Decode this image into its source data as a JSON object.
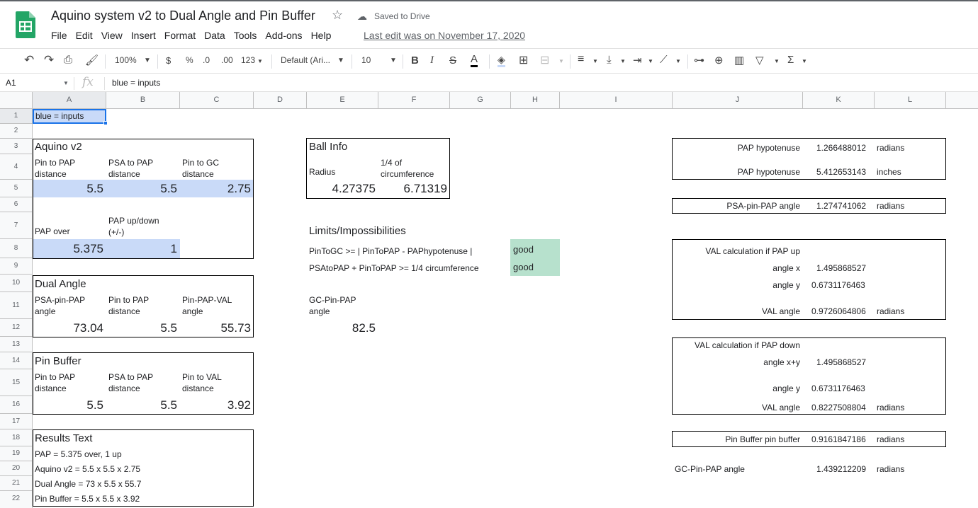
{
  "doc": {
    "title": "Aquino system v2 to Dual Angle and Pin Buffer",
    "saved": "Saved to Drive",
    "last_edit": "Last edit was on November 17, 2020",
    "menu": [
      "File",
      "Edit",
      "View",
      "Insert",
      "Format",
      "Data",
      "Tools",
      "Add-ons",
      "Help"
    ]
  },
  "toolbar": {
    "zoom": "100%",
    "currency": "$",
    "percent": "%",
    "dec_less": ".0",
    "dec_more": ".00",
    "format_more": "123",
    "font": "Default (Ari...",
    "font_size": "10"
  },
  "formula_bar": {
    "cell_ref": "A1",
    "fx": "fx",
    "value": "blue = inputs"
  },
  "columns": [
    "A",
    "B",
    "C",
    "D",
    "E",
    "F",
    "G",
    "H",
    "I",
    "J",
    "K",
    "L"
  ],
  "rows": [
    "1",
    "2",
    "3",
    "4",
    "5",
    "6",
    "7",
    "8",
    "9",
    "10",
    "11",
    "12",
    "13",
    "14",
    "15",
    "16",
    "17",
    "18",
    "19",
    "20",
    "21",
    "22"
  ],
  "cells": {
    "a1": "blue = inputs",
    "aquino": {
      "title": "Aquino v2",
      "pin_pap": "Pin to PAP\ndistance",
      "psa_pap": "PSA to PAP\ndistance",
      "pin_gc": "Pin to GC\ndistance",
      "v_pin_pap": "5.5",
      "v_psa_pap": "5.5",
      "v_pin_gc": "2.75",
      "pap_over": "PAP over",
      "pap_updown": "PAP up/down\n(+/-)",
      "v_pap_over": "5.375",
      "v_pap_updown": "1"
    },
    "dual": {
      "title": "Dual Angle",
      "psa_pin_pap": "PSA-pin-PAP\nangle",
      "pin_pap": "Pin to PAP\ndistance",
      "pin_pap_val": "Pin-PAP-VAL\nangle",
      "v1": "73.04",
      "v2": "5.5",
      "v3": "55.73"
    },
    "buffer": {
      "title": "Pin Buffer",
      "pin_pap": "Pin to PAP\ndistance",
      "psa_pap": "PSA to PAP\ndistance",
      "pin_val": "Pin to VAL\ndistance",
      "v1": "5.5",
      "v2": "5.5",
      "v3": "3.92"
    },
    "results": {
      "title": "Results Text",
      "lines": [
        "PAP = 5.375 over, 1 up",
        "Aquino v2 = 5.5 x 5.5 x 2.75",
        "Dual Angle = 73 x 5.5 x 55.7",
        "Pin Buffer = 5.5 x 5.5 x 3.92"
      ]
    },
    "ball": {
      "title": "Ball Info",
      "radius": "Radius",
      "quarter": "1/4 of\ncircumference",
      "v_radius": "4.27375",
      "v_quarter": "6.71319"
    },
    "limits": {
      "title": "Limits/Impossibilities",
      "rule1": "PinToGC >= | PinToPAP - PAPhypotenuse |",
      "rule2": "PSAtoPAP + PinToPAP >= 1/4 circumference",
      "r1": "good",
      "r2": "good"
    },
    "gc": {
      "label": "GC-Pin-PAP\nangle",
      "value": "82.5"
    },
    "calc": {
      "hyp1_label": "PAP hypotenuse",
      "hyp1_value": "1.266488012",
      "hyp1_unit": "radians",
      "hyp2_label": "PAP hypotenuse",
      "hyp2_value": "5.412653143",
      "hyp2_unit": "inches",
      "psa_label": "PSA-pin-PAP angle",
      "psa_value": "1.274741062",
      "psa_unit": "radians",
      "up_title": "VAL calculation if PAP up",
      "up_x_label": "angle x",
      "up_x": "1.495868527",
      "up_y_label": "angle y",
      "up_y": "0.6731176463",
      "up_val_label": "VAL angle",
      "up_val": "0.9726064806",
      "up_val_unit": "radians",
      "down_title": "VAL calculation if PAP down",
      "down_xy_label": "angle x+y",
      "down_xy": "1.495868527",
      "down_y_label": "angle y",
      "down_y": "0.6731176463",
      "down_val_label": "VAL angle",
      "down_val": "0.8227508804",
      "down_val_unit": "radians",
      "buf_label": "Pin Buffer pin buffer",
      "buf_value": "0.9161847186",
      "buf_unit": "radians",
      "gc_label": "GC-Pin-PAP angle",
      "gc_value": "1.439212209",
      "gc_unit": "radians"
    }
  }
}
